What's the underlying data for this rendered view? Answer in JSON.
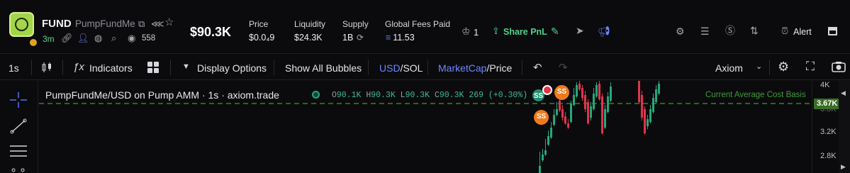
{
  "header": {
    "ticker": "FUND",
    "name": "PumpFundMe",
    "age": "3m",
    "holders": "558",
    "market_cap": "$90.3K",
    "stats": [
      {
        "label": "Price",
        "value": "$0.0₄9"
      },
      {
        "label": "Liquidity",
        "value": "$24.3K"
      },
      {
        "label": "Supply",
        "value": "1B"
      },
      {
        "label": "Global Fees Paid",
        "value": "11.53"
      }
    ],
    "crown_count": "1",
    "share_label": "Share PnL",
    "alert_label": "Alert"
  },
  "toolbar": {
    "interval": "1s",
    "indicators": "Indicators",
    "display_options": "Display Options",
    "show_bubbles": "Show All Bubbles",
    "usd": "USD",
    "sol": "SOL",
    "slash": "/",
    "mcap": "MarketCap",
    "price": "Price",
    "platform": "Axiom"
  },
  "chart": {
    "pair_title": "PumpFundMe/USD on Pump AMM · 1s · axiom.trade",
    "ohlc": {
      "o": "90.1K",
      "h": "90.3K",
      "l": "90.3K",
      "c": "90.3K",
      "change": "269 (+0.30%)"
    },
    "ohlc_keys": {
      "o": "O",
      "h": "H",
      "l": "L",
      "c": "C"
    },
    "cost_basis_label": "Current Average Cost Basis",
    "cost_basis_value": "3.67K",
    "axis_labels": [
      "4K",
      "3.8K",
      "3.2K",
      "2.8K"
    ],
    "bubble_label": "SS",
    "colors": {
      "up": "#25a77a",
      "down": "#e2334c",
      "cost_line": "#3f9a3a",
      "accent": "#6f86ff"
    }
  }
}
